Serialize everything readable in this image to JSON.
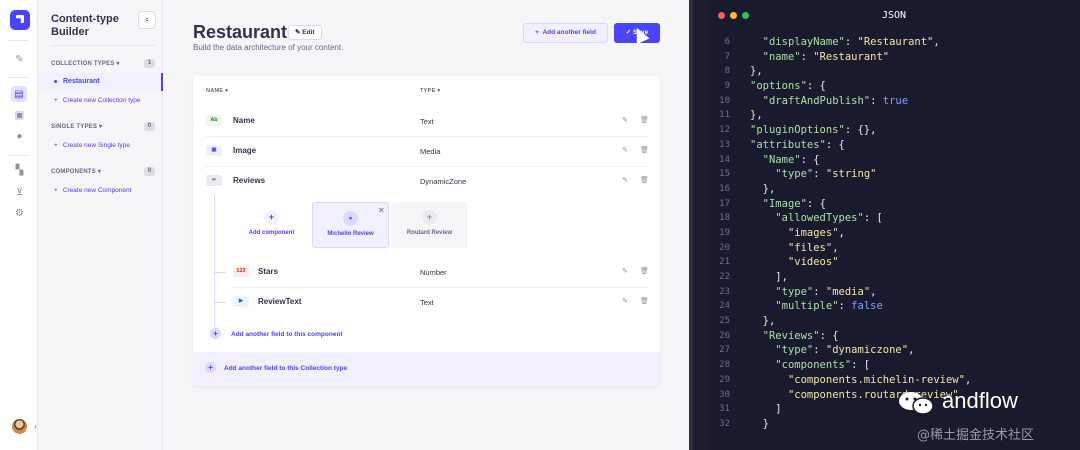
{
  "sidebar": {
    "title": "Content-type Builder",
    "sections": [
      {
        "label": "COLLECTION TYPES",
        "count": "1",
        "items": [
          {
            "label": "Restaurant"
          }
        ],
        "link": "Create new Collection type"
      },
      {
        "label": "SINGLE TYPES",
        "count": "0",
        "items": [],
        "link": "Create new Single type"
      },
      {
        "label": "COMPONENTS",
        "count": "0",
        "items": [],
        "link": "Create new Component"
      }
    ]
  },
  "header": {
    "title": "Restaurant",
    "edit_label": "Edit",
    "subtitle": "Build the data architecture of your content.",
    "add_field_label": "Add another field",
    "save_label": "Save"
  },
  "table": {
    "col_name": "NAME",
    "col_type": "TYPE",
    "rows": [
      {
        "icon": "Ab",
        "name": "Name",
        "type": "Text"
      },
      {
        "icon": "img",
        "name": "Image",
        "type": "Media"
      },
      {
        "icon": "dz",
        "name": "Reviews",
        "type": "DynamicZone"
      }
    ],
    "components": [
      {
        "label": "Add component"
      },
      {
        "label": "Michelin Review"
      },
      {
        "label": "Routard Review"
      }
    ],
    "sub_rows": [
      {
        "icon": "123",
        "name": "Stars",
        "type": "Number"
      },
      {
        "icon": "txt",
        "name": "ReviewText",
        "type": "Text"
      }
    ],
    "add_component_field": "Add another field to this component",
    "add_collection_field": "Add another field to this Collection type"
  },
  "json_panel": {
    "title": "JSON",
    "lines": [
      {
        "no": "6",
        "text": "  \"displayName\": \"Restaurant\","
      },
      {
        "no": "7",
        "text": "  \"name\": \"Restaurant\""
      },
      {
        "no": "8",
        "text": "},"
      },
      {
        "no": "9",
        "text": "\"options\": {"
      },
      {
        "no": "10",
        "text": "  \"draftAndPublish\": true"
      },
      {
        "no": "11",
        "text": "},"
      },
      {
        "no": "12",
        "text": "\"pluginOptions\": {},"
      },
      {
        "no": "13",
        "text": "\"attributes\": {"
      },
      {
        "no": "14",
        "text": "  \"Name\": {"
      },
      {
        "no": "15",
        "text": "    \"type\": \"string\""
      },
      {
        "no": "16",
        "text": "  },"
      },
      {
        "no": "17",
        "text": "  \"Image\": {"
      },
      {
        "no": "18",
        "text": "    \"allowedTypes\": ["
      },
      {
        "no": "19",
        "text": "      \"images\","
      },
      {
        "no": "20",
        "text": "      \"files\","
      },
      {
        "no": "21",
        "text": "      \"videos\""
      },
      {
        "no": "22",
        "text": "    ],"
      },
      {
        "no": "23",
        "text": "    \"type\": \"media\","
      },
      {
        "no": "24",
        "text": "    \"multiple\": false"
      },
      {
        "no": "25",
        "text": "  },"
      },
      {
        "no": "26",
        "text": "  \"Reviews\": {"
      },
      {
        "no": "27",
        "text": "    \"type\": \"dynamiczone\","
      },
      {
        "no": "28",
        "text": "    \"components\": ["
      },
      {
        "no": "29",
        "text": "      \"components.michelin-review\","
      },
      {
        "no": "30",
        "text": "      \"components.routard-review\""
      },
      {
        "no": "31",
        "text": "    ]"
      },
      {
        "no": "32",
        "text": "  }"
      }
    ]
  },
  "watermark": {
    "brand": "andflow",
    "sub": "@稀土掘金技术社区"
  },
  "colors": {
    "accent": "#4945ff",
    "accent_light": "#f0f0ff",
    "text": "#32324d",
    "terminal_bg": "#1a1a2e"
  }
}
